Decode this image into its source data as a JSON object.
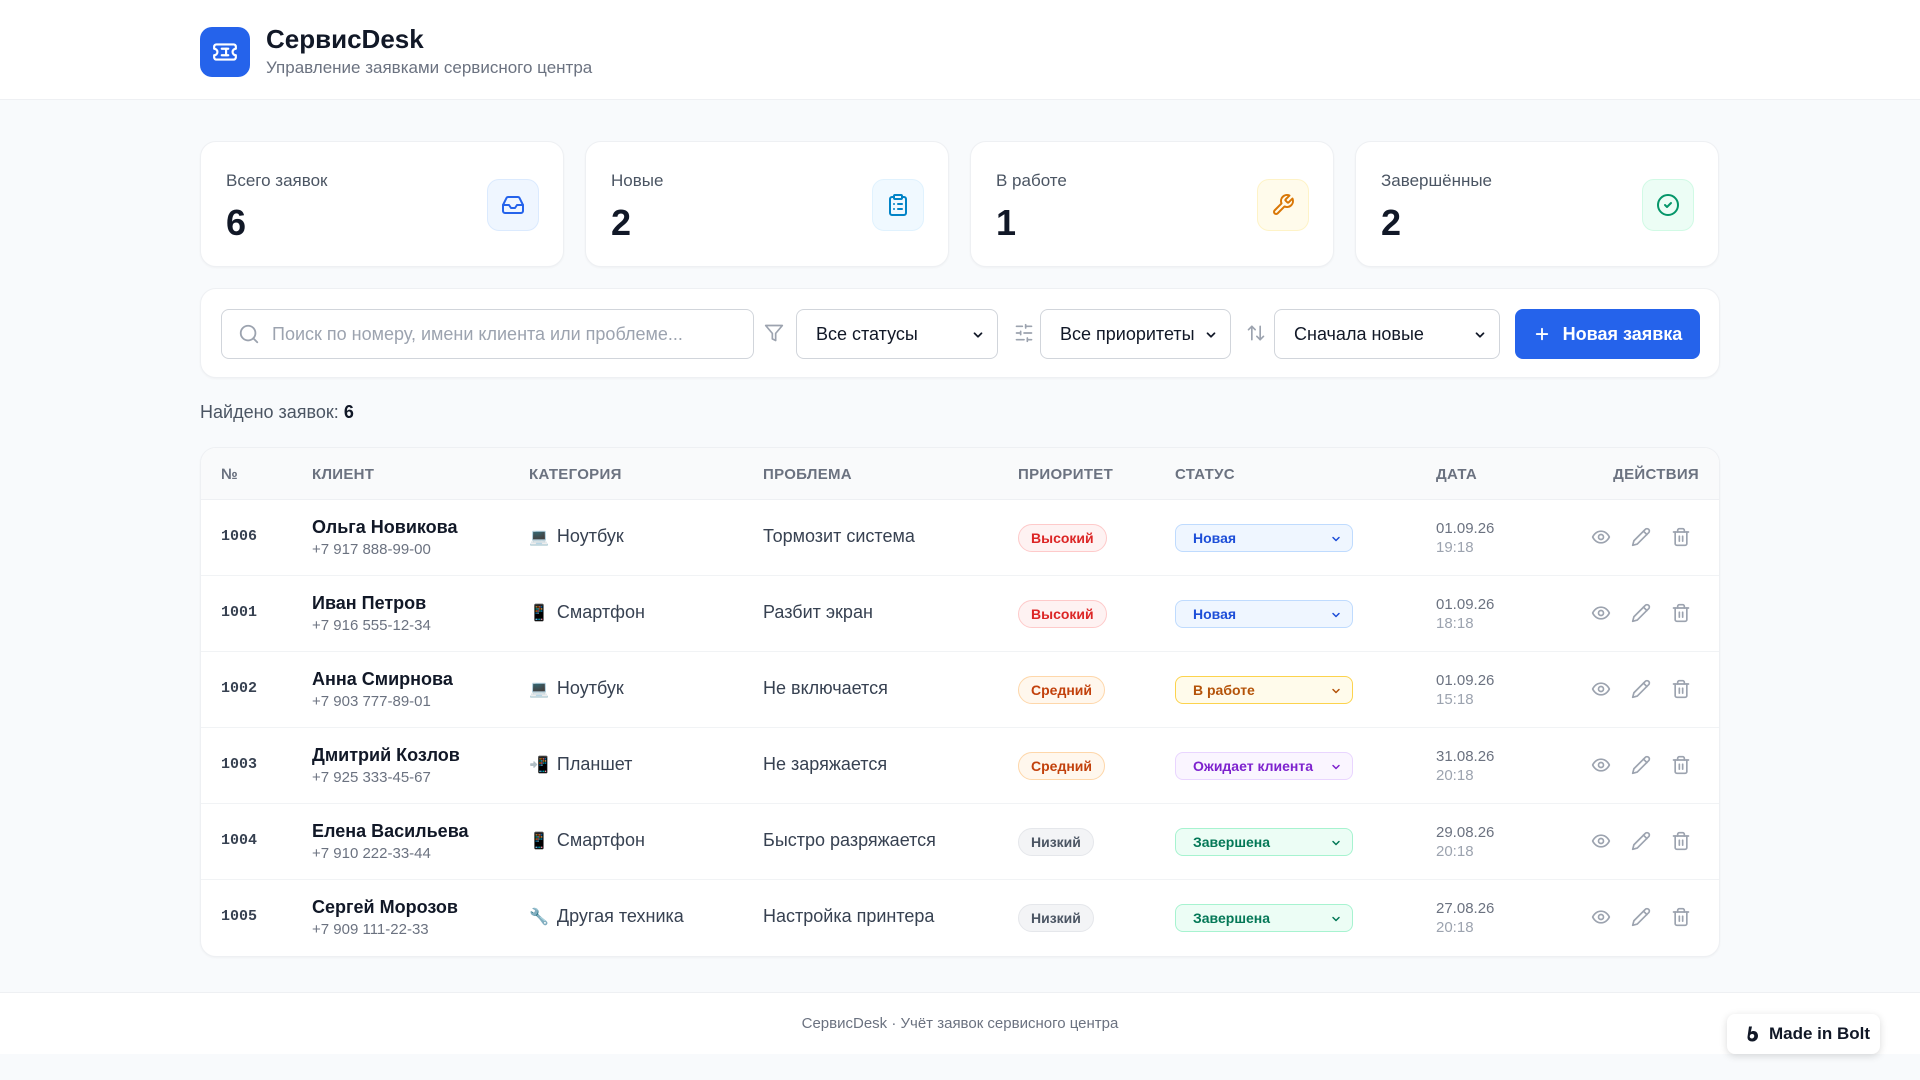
{
  "app": {
    "title": "СервисDesk",
    "subtitle": "Управление заявками сервисного центра",
    "accent_color": "#2563eb"
  },
  "stats": [
    {
      "label": "Всего заявок",
      "value": "6",
      "icon": "inbox-icon",
      "color": "#2563eb"
    },
    {
      "label": "Новые",
      "value": "2",
      "icon": "clipboard-icon",
      "color": "#0284c7"
    },
    {
      "label": "В работе",
      "value": "1",
      "icon": "wrench-icon",
      "color": "#d97706"
    },
    {
      "label": "Завершённые",
      "value": "2",
      "icon": "check-circle-icon",
      "color": "#059669"
    }
  ],
  "toolbar": {
    "search_placeholder": "Поиск по номеру, имени клиента или проблеме...",
    "status_filter": "Все статусы",
    "priority_filter": "Все приоритеты",
    "sort": "Сначала новые",
    "new_button": "Новая заявка"
  },
  "found": {
    "label": "Найдено заявок:",
    "count": "6"
  },
  "table": {
    "headers": {
      "num": "№",
      "client": "КЛИЕНТ",
      "category": "КАТЕГОРИЯ",
      "problem": "ПРОБЛЕМА",
      "priority": "ПРИОРИТЕТ",
      "status": "СТАТУС",
      "date": "ДАТА",
      "actions": "ДЕЙСТВИЯ"
    },
    "rows": [
      {
        "num": "1006",
        "name": "Ольга Новикова",
        "phone": "+7 917 888-99-00",
        "category_emoji": "💻",
        "category": "Ноутбук",
        "problem": "Тормозит система",
        "priority": "Высокий",
        "priority_level": "high",
        "status": "Новая",
        "status_key": "new",
        "date": "01.09.26",
        "time": "19:18"
      },
      {
        "num": "1001",
        "name": "Иван Петров",
        "phone": "+7 916 555-12-34",
        "category_emoji": "📱",
        "category": "Смартфон",
        "problem": "Разбит экран",
        "priority": "Высокий",
        "priority_level": "high",
        "status": "Новая",
        "status_key": "new",
        "date": "01.09.26",
        "time": "18:18"
      },
      {
        "num": "1002",
        "name": "Анна Смирнова",
        "phone": "+7 903 777-89-01",
        "category_emoji": "💻",
        "category": "Ноутбук",
        "problem": "Не включается",
        "priority": "Средний",
        "priority_level": "medium",
        "status": "В работе",
        "status_key": "work",
        "date": "01.09.26",
        "time": "15:18"
      },
      {
        "num": "1003",
        "name": "Дмитрий Козлов",
        "phone": "+7 925 333-45-67",
        "category_emoji": "📲",
        "category": "Планшет",
        "problem": "Не заряжается",
        "priority": "Средний",
        "priority_level": "medium",
        "status": "Ожидает клиента",
        "status_key": "wait",
        "date": "31.08.26",
        "time": "20:18"
      },
      {
        "num": "1004",
        "name": "Елена Васильева",
        "phone": "+7 910 222-33-44",
        "category_emoji": "📱",
        "category": "Смартфон",
        "problem": "Быстро разряжается",
        "priority": "Низкий",
        "priority_level": "low",
        "status": "Завершена",
        "status_key": "done",
        "date": "29.08.26",
        "time": "20:18"
      },
      {
        "num": "1005",
        "name": "Сергей Морозов",
        "phone": "+7 909 111-22-33",
        "category_emoji": "🔧",
        "category": "Другая техника",
        "problem": "Настройка принтера",
        "priority": "Низкий",
        "priority_level": "low",
        "status": "Завершена",
        "status_key": "done",
        "date": "27.08.26",
        "time": "20:18"
      }
    ]
  },
  "footer": {
    "text": "СервисDesk · Учёт заявок сервисного центра"
  },
  "badge": {
    "label": "Made in Bolt"
  },
  "colors": {
    "priority": {
      "high": {
        "bg": "#fef2f2",
        "border": "#fecaca",
        "text": "#dc2626"
      },
      "medium": {
        "bg": "#fff7ed",
        "border": "#fed7aa",
        "text": "#c2410c"
      },
      "low": {
        "bg": "#f3f4f6",
        "border": "#e5e7eb",
        "text": "#4b5563"
      }
    },
    "status": {
      "new": {
        "bg": "#eff6ff",
        "border": "#bfdbfe",
        "text": "#1d4ed8"
      },
      "work": {
        "bg": "#fffbeb",
        "border": "#fcd34d",
        "text": "#b45309"
      },
      "wait": {
        "bg": "#faf5ff",
        "border": "#e9d5ff",
        "text": "#7e22ce"
      },
      "done": {
        "bg": "#ecfdf5",
        "border": "#a7f3d0",
        "text": "#047857"
      }
    }
  }
}
